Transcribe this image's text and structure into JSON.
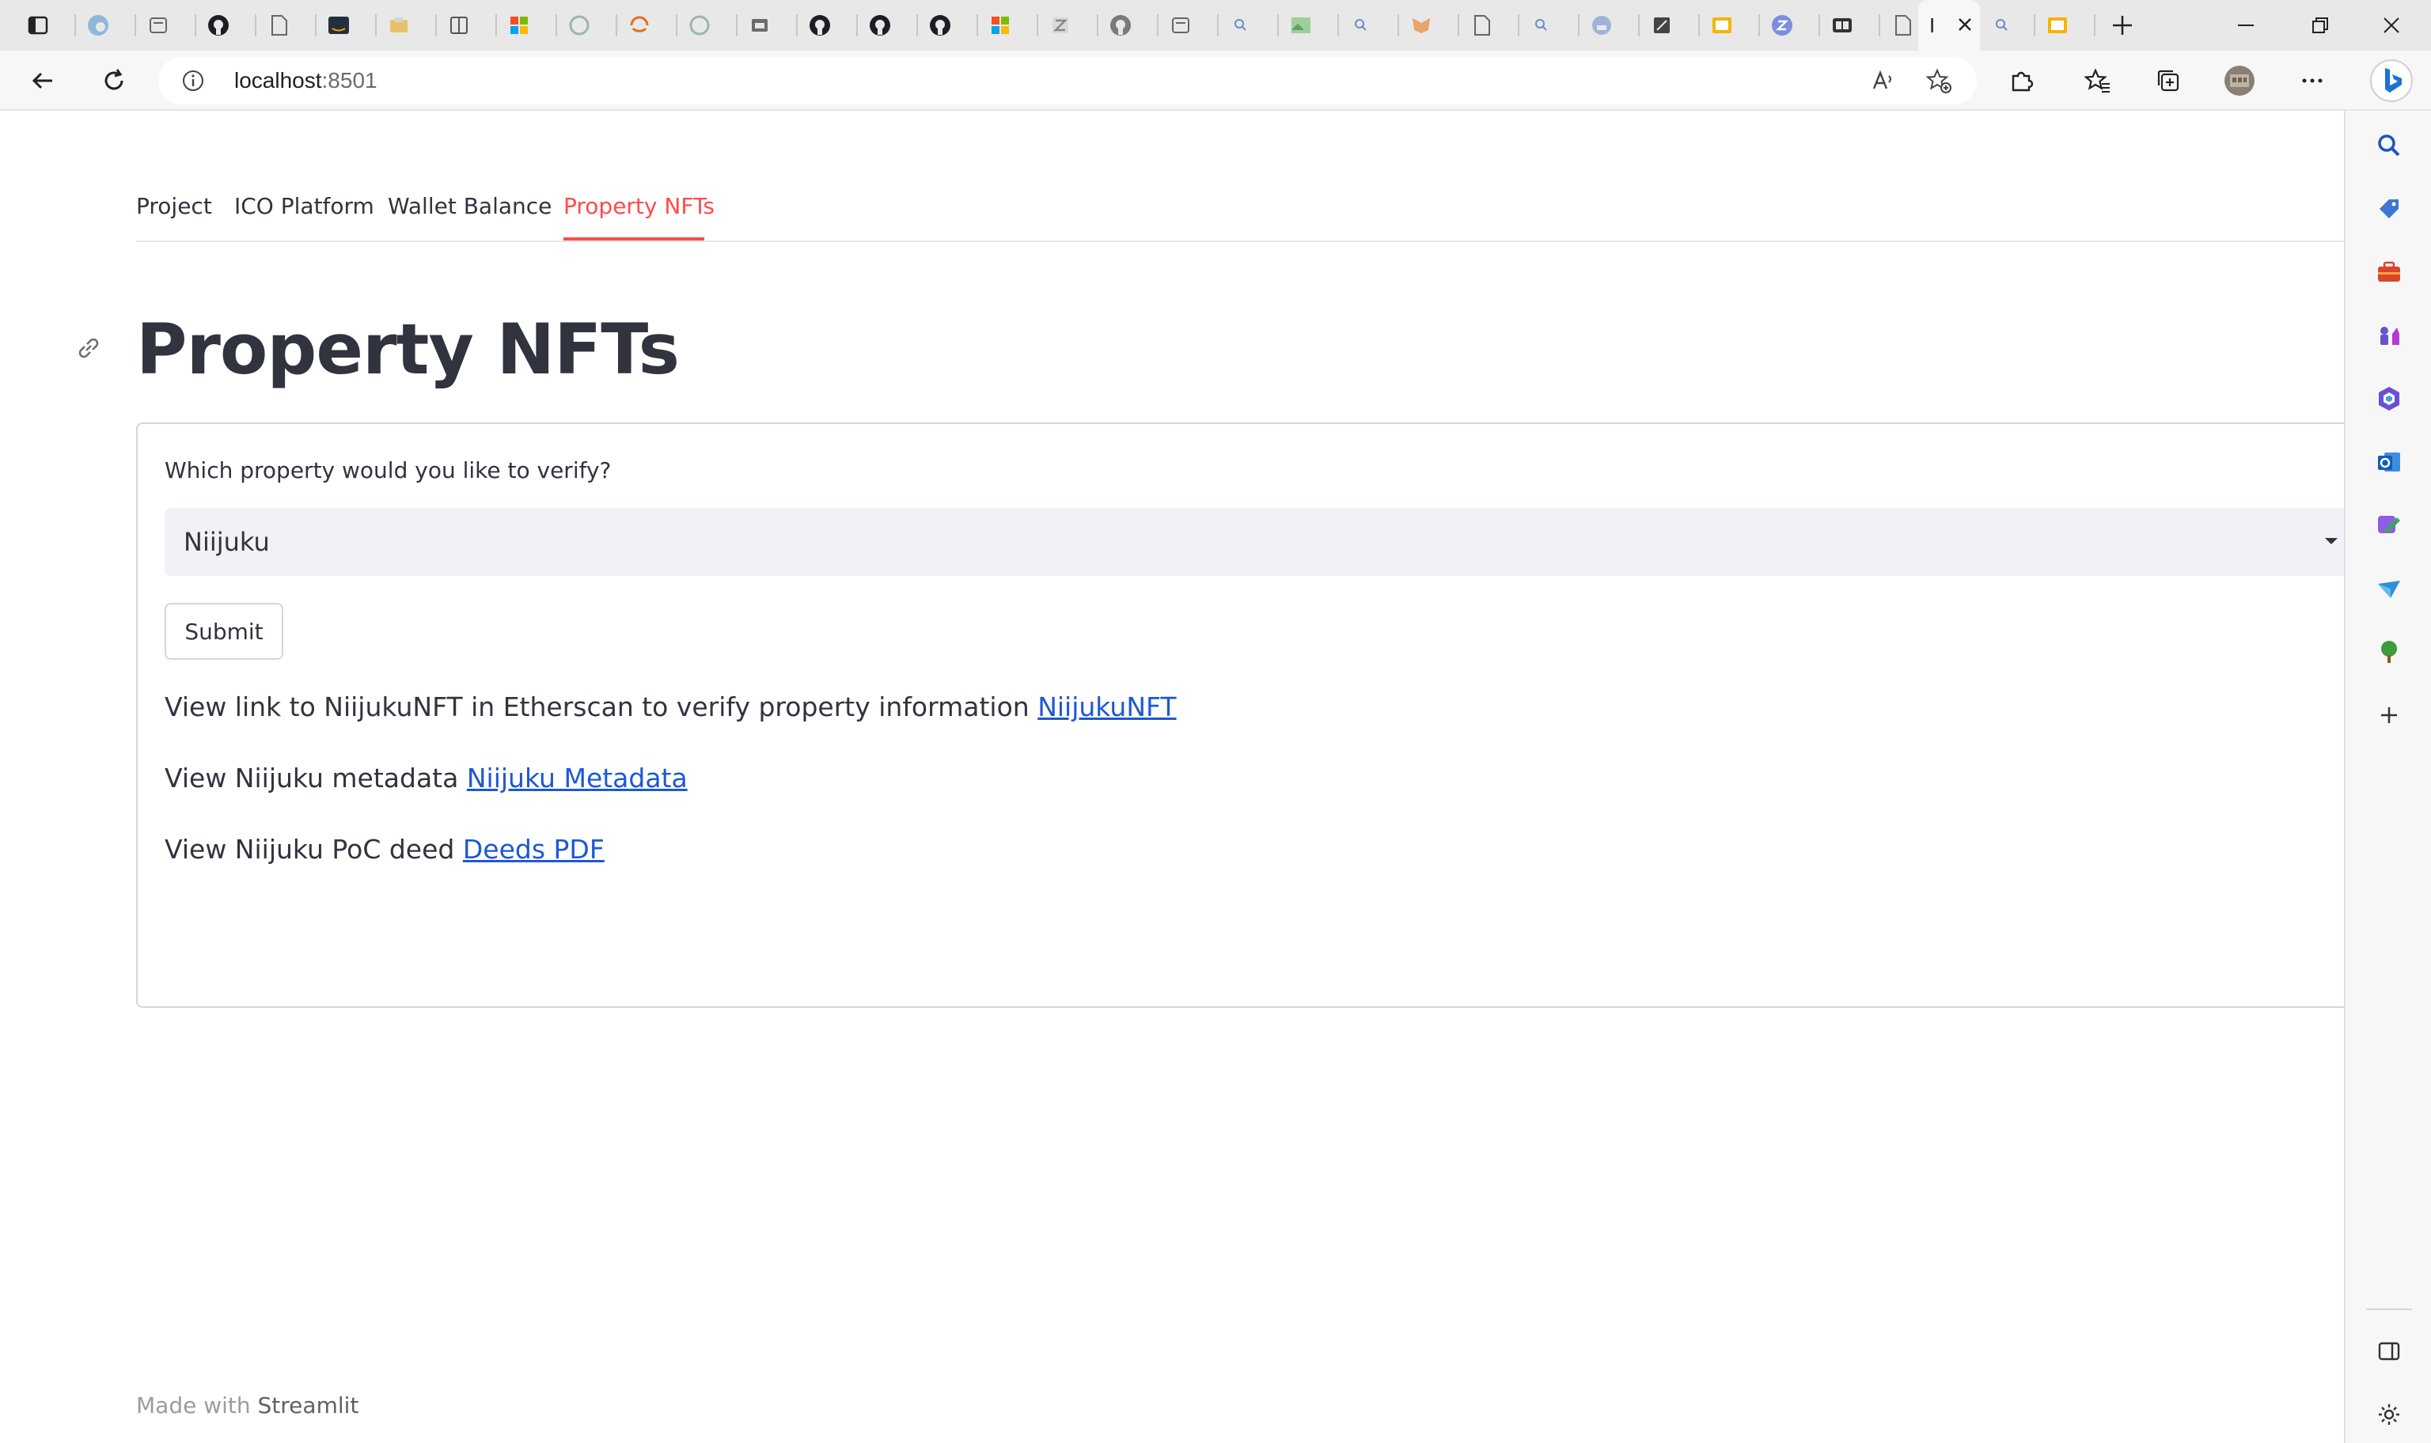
{
  "browser": {
    "address_bar": {
      "host": "localhost",
      "port": ":8501"
    },
    "tab_icons": [
      "sidebar-toggle-icon",
      "edge-icon",
      "tab-icon",
      "github-icon",
      "doc-icon",
      "aws-icon",
      "folder-icon",
      "reader-icon",
      "microsoft-icon",
      "openai-icon",
      "orange-swirl-icon",
      "openai-icon",
      "bank-icon",
      "github-icon",
      "github-icon",
      "github-icon",
      "microsoft-icon",
      "zotero-icon",
      "github-icon",
      "tab-icon",
      "search-icon",
      "image-icon",
      "search-icon",
      "metamask-icon",
      "doc-icon",
      "search-icon",
      "cloud-icon",
      "mirror-icon",
      "slides-icon",
      "z-icon",
      "video-icon",
      "doc-icon"
    ],
    "active_tab_label": "I",
    "after_tab_icons": [
      "search-icon",
      "slides-icon"
    ]
  },
  "streamlit": {
    "tabs": [
      {
        "label": "Project"
      },
      {
        "label": "ICO Platform"
      },
      {
        "label": "Wallet Balance"
      },
      {
        "label": "Property NFTs",
        "active": true
      }
    ],
    "title": "Property NFTs",
    "form": {
      "question": "Which property would you like to verify?",
      "selected": "Niijuku",
      "submit_label": "Submit"
    },
    "links": [
      {
        "text": "View link to NiijukuNFT in Etherscan to verify property information",
        "link_text": "NiijukuNFT"
      },
      {
        "text": "View Niijuku metadata",
        "link_text": "Niijuku Metadata"
      },
      {
        "text": "View Niijuku PoC deed",
        "link_text": "Deeds PDF"
      }
    ],
    "footer": {
      "prefix": "Made with",
      "brand": "Streamlit"
    }
  },
  "colors": {
    "accent": "#ff4b4b",
    "link": "#1c58d6",
    "text": "#31333f",
    "select_bg": "#f0f2f6"
  }
}
